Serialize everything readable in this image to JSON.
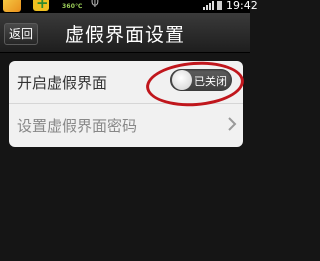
{
  "status_bar": {
    "label": "360℃",
    "time": "19:42"
  },
  "header": {
    "back_label": "返回",
    "title": "虚假界面设置"
  },
  "settings": {
    "items": [
      {
        "label": "开启虚假界面",
        "toggle_state": "已关闭",
        "enabled": false
      },
      {
        "label": "设置虚假界面密码"
      }
    ]
  },
  "colors": {
    "highlight": "#c0161c",
    "card_bg": "#f1f1f1",
    "toggle_bg": "#4a4a4a"
  }
}
